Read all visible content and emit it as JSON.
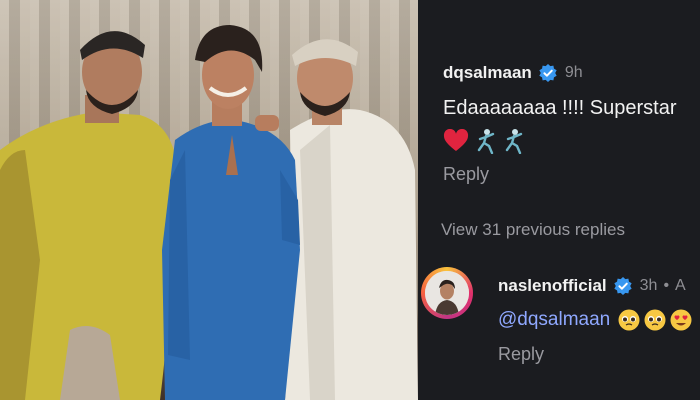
{
  "photo": {
    "description_icon": "photo-of-three-men"
  },
  "comment1": {
    "username": "dqsalmaan",
    "time": "9h",
    "text": "Edaaaaaaaa !!!! Superstar",
    "emojis": [
      "heart-icon",
      "dancing-man-icon",
      "dancing-man-icon"
    ],
    "reply_label": "Reply"
  },
  "view_replies_label": "View 31 previous replies",
  "comment2": {
    "username": "naslenofficial",
    "time": "3h",
    "separator": "•",
    "trailing": "A",
    "mention": "@dqsalmaan",
    "emojis": [
      "pleading-face-icon",
      "pleading-face-icon",
      "heart-eyes-icon"
    ],
    "reply_label": "Reply"
  },
  "colors": {
    "verified": "#3897f0",
    "mention": "#8fa8ff",
    "heart": "#e0243f"
  }
}
